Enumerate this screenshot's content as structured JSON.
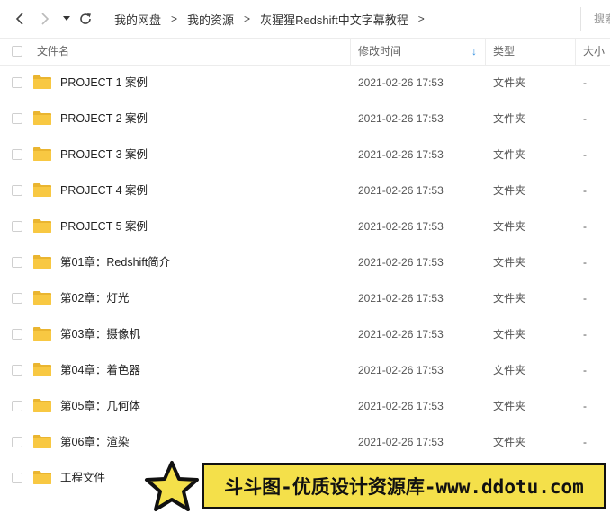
{
  "toolbar": {
    "breadcrumbs": [
      "我的网盘",
      "我的资源",
      "灰猩猩Redshift中文字幕教程"
    ],
    "separator": ">",
    "search_placeholder": "搜索"
  },
  "table": {
    "headers": {
      "name": "文件名",
      "modified": "修改时间",
      "type": "类型",
      "size": "大小"
    },
    "sort_indicator": "↓",
    "rows": [
      {
        "name": "PROJECT 1 案例",
        "modified": "2021-02-26 17:53",
        "type": "文件夹",
        "size": "-"
      },
      {
        "name": "PROJECT 2 案例",
        "modified": "2021-02-26 17:53",
        "type": "文件夹",
        "size": "-"
      },
      {
        "name": "PROJECT 3 案例",
        "modified": "2021-02-26 17:53",
        "type": "文件夹",
        "size": "-"
      },
      {
        "name": "PROJECT 4 案例",
        "modified": "2021-02-26 17:53",
        "type": "文件夹",
        "size": "-"
      },
      {
        "name": "PROJECT 5 案例",
        "modified": "2021-02-26 17:53",
        "type": "文件夹",
        "size": "-"
      },
      {
        "name": "第01章：Redshift简介",
        "modified": "2021-02-26 17:53",
        "type": "文件夹",
        "size": "-"
      },
      {
        "name": "第02章：灯光",
        "modified": "2021-02-26 17:53",
        "type": "文件夹",
        "size": "-"
      },
      {
        "name": "第03章：摄像机",
        "modified": "2021-02-26 17:53",
        "type": "文件夹",
        "size": "-"
      },
      {
        "name": "第04章：着色器",
        "modified": "2021-02-26 17:53",
        "type": "文件夹",
        "size": "-"
      },
      {
        "name": "第05章：几何体",
        "modified": "2021-02-26 17:53",
        "type": "文件夹",
        "size": "-"
      },
      {
        "name": "第06章：渲染",
        "modified": "2021-02-26 17:53",
        "type": "文件夹",
        "size": "-"
      },
      {
        "name": "工程文件",
        "modified": "",
        "type": "",
        "size": ""
      }
    ]
  },
  "watermark": {
    "text": "斗斗图-优质设计资源库-www.ddotu.com",
    "bg_color": "#f4e04a",
    "icon": "star-icon"
  },
  "colors": {
    "folder": "#f8c842",
    "folder_tab": "#eab530",
    "sort_arrow": "#2f8ee0"
  }
}
